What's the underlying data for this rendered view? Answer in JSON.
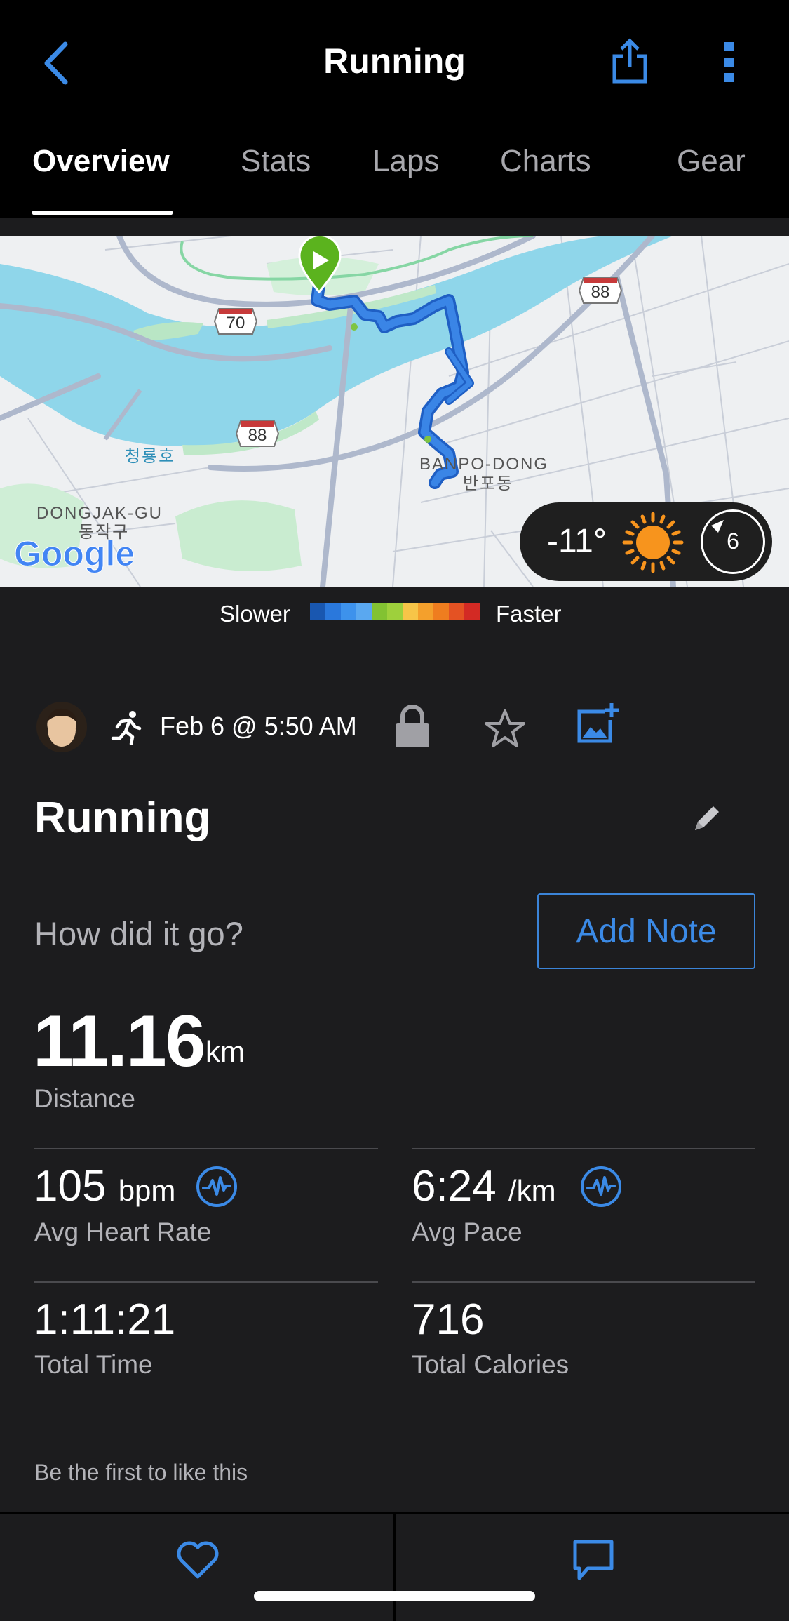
{
  "header": {
    "title": "Running",
    "back_icon": "chevron-left-icon",
    "share_icon": "share-icon",
    "more_icon": "more-vertical-icon"
  },
  "tabs": [
    {
      "label": "Overview",
      "active": true
    },
    {
      "label": "Stats",
      "active": false
    },
    {
      "label": "Laps",
      "active": false
    },
    {
      "label": "Charts",
      "active": false
    },
    {
      "label": "Gear",
      "active": false
    }
  ],
  "map": {
    "labels": {
      "banpo_en": "BANPO-DONG",
      "banpo_ko": "반포동",
      "dongjak_en": "DONGJAK-GU",
      "dongjak_ko": "동작구",
      "lake": "청룡호",
      "road_70": "70",
      "road_88_a": "88",
      "road_88_b": "88"
    },
    "attribution": "Google",
    "weather": {
      "temperature": "-11°",
      "condition_icon": "sun-icon",
      "wind_icon": "wind-direction-icon",
      "wind_speed": "6"
    }
  },
  "pace_legend": {
    "slower_label": "Slower",
    "faster_label": "Faster",
    "colors": [
      "#1957b0",
      "#2a78dc",
      "#3d92ec",
      "#5aa8f0",
      "#82c232",
      "#9ed03c",
      "#f7c548",
      "#f4a02c",
      "#ef7d1f",
      "#e45223",
      "#d32a24"
    ]
  },
  "activity": {
    "type_icon": "runner-icon",
    "date": "Feb 6 @ 5:50 AM",
    "privacy_icon": "lock-icon",
    "favorite_icon": "star-icon",
    "add_photo_icon": "add-photo-icon",
    "name": "Running",
    "edit_icon": "pencil-icon",
    "note_prompt": "How did it go?",
    "add_note_label": "Add Note"
  },
  "summary": {
    "distance": {
      "value": "11.16",
      "unit": "km",
      "label": "Distance"
    },
    "avg_heart_rate": {
      "value": "105",
      "unit": "bpm",
      "label": "Avg Heart Rate"
    },
    "avg_pace": {
      "value": "6:24",
      "unit": "/km",
      "label": "Avg Pace"
    },
    "total_time": {
      "value": "1:11:21",
      "label": "Total Time"
    },
    "total_calories": {
      "value": "716",
      "label": "Total Calories"
    }
  },
  "social": {
    "likes_text": "Be the first to like this",
    "like_icon": "heart-icon",
    "comment_icon": "comment-icon"
  },
  "colors": {
    "accent": "#3b8ae6",
    "background": "#1c1c1e",
    "header_bg": "#000000",
    "secondary_text": "#b3b3b8",
    "route": "#3a7fe0",
    "start_marker": "#5bb31e",
    "sun": "#f7941d"
  }
}
